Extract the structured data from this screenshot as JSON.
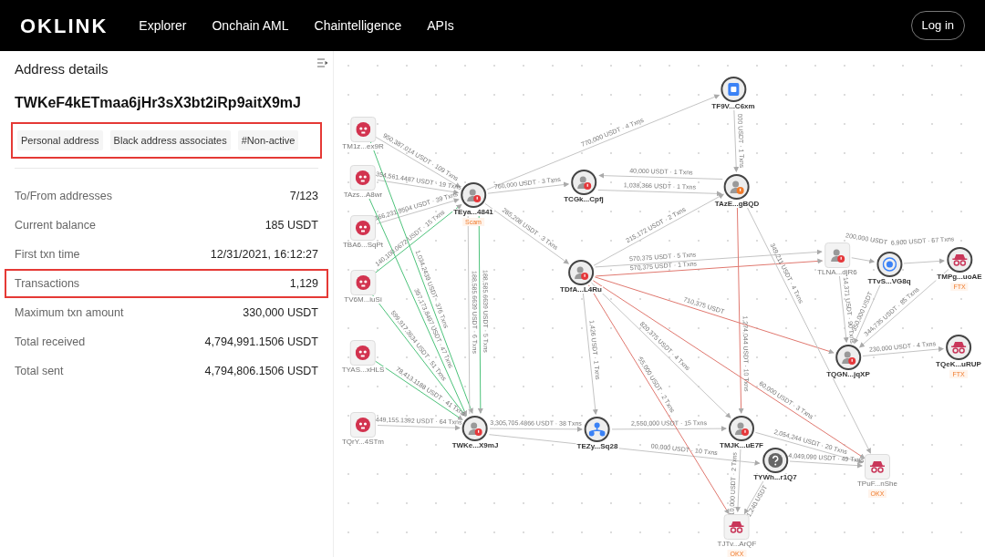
{
  "nav": {
    "logo": "OKLINK",
    "links": [
      "Explorer",
      "Onchain AML",
      "Chaintelligence",
      "APIs"
    ],
    "login": "Log in"
  },
  "details": {
    "title": "Address details",
    "address": "TWKeF4kETmaa6jHr3sX3bt2iRp9aitX9mJ",
    "tags": [
      "Personal address",
      "Black address associates",
      "#Non-active"
    ],
    "tags_highlighted": true,
    "rows": [
      {
        "label": "To/From addresses",
        "value": "7/123",
        "highlighted": false
      },
      {
        "label": "Current balance",
        "value": "185 USDT",
        "highlighted": false
      },
      {
        "label": "First txn time",
        "value": "12/31/2021, 16:12:27",
        "highlighted": false
      },
      {
        "label": "Transactions",
        "value": "1,129",
        "highlighted": true
      },
      {
        "label": "Maximum txn amount",
        "value": "330,000 USDT",
        "highlighted": false
      },
      {
        "label": "Total received",
        "value": "4,794,991.1506 USDT",
        "highlighted": false
      },
      {
        "label": "Total sent",
        "value": "4,794,806.1506 USDT",
        "highlighted": false
      }
    ]
  },
  "graph": {
    "nodes": [
      {
        "label": "TM1z...ex9R",
        "kind": "risk"
      },
      {
        "label": "TAzs...A8wr",
        "kind": "risk"
      },
      {
        "label": "TBA6...SqPt",
        "kind": "risk"
      },
      {
        "label": "TV6M...iuSi",
        "kind": "risk"
      },
      {
        "label": "TYAS...xHLS",
        "kind": "risk"
      },
      {
        "label": "TQrY...4STm",
        "kind": "risk"
      },
      {
        "label": "TEya...4841",
        "kind": "address",
        "color": "#e5383b",
        "tag": "Scam"
      },
      {
        "label": "TWKe...X9mJ",
        "kind": "address",
        "color": "#e5383b"
      },
      {
        "label": "TCGk...Cpfj",
        "kind": "address",
        "color": "#e5383b"
      },
      {
        "label": "TF9V...C6xm",
        "kind": "contract"
      },
      {
        "label": "TAzE...gBQD",
        "kind": "address",
        "color": "#f07a2a"
      },
      {
        "label": "TDfA...L4Ru",
        "kind": "address",
        "color": "#e5383b"
      },
      {
        "label": "TEZy...Sq28",
        "kind": "hub"
      },
      {
        "label": "TLNA...djR6",
        "kind": "address",
        "color": "#e5383b"
      },
      {
        "label": "TTvS...VG8q",
        "kind": "exchange"
      },
      {
        "label": "TMPg...uoAE",
        "kind": "entity",
        "tag": "FTX"
      },
      {
        "label": "TQGN...jqXP",
        "kind": "address",
        "color": "#e5383b"
      },
      {
        "label": "TQeK...uRUP",
        "kind": "entity",
        "tag": "FTX"
      },
      {
        "label": "TMJK...uE7F",
        "kind": "address",
        "color": "#e5383b"
      },
      {
        "label": "TYWh...r1Q7",
        "kind": "unknown"
      },
      {
        "label": "TPuF...nShe",
        "kind": "entity",
        "tag": "OKX"
      },
      {
        "label": "TJTv...ArQF",
        "kind": "entity",
        "tag": "OKX"
      }
    ],
    "edges": [
      {
        "label": "950,387.014 USDT · 109 Txns",
        "color": "#c4c4c4"
      },
      {
        "label": "354,561.4487 USDT · 19 Txns",
        "color": "#c4c4c4"
      },
      {
        "label": "166,231.9504 USDT · 39 Txns",
        "color": "#c4c4c4"
      },
      {
        "label": "140,100.0672 USDT · 15 Txns",
        "color": "#4cc27a"
      },
      {
        "label": "1,034.2439 USDT · 376 Txns",
        "color": "#4cc27a"
      },
      {
        "label": "397,173.8497 USDT · 47 Txns",
        "color": "#4cc27a"
      },
      {
        "label": "188,585.6639 USDT · 5 Txns",
        "color": "#4cc27a"
      },
      {
        "label": "188,585.6639 USDT · 6 Txns",
        "color": "#c4c4c4"
      },
      {
        "label": "599,917.3634 USDT · 51 Txns",
        "color": "#4cc27a"
      },
      {
        "label": "78,413.1188 USDT · 41 Txns",
        "color": "#4cc27a"
      },
      {
        "label": "449,155.1392 USDT · 64 Txns",
        "color": "#c4c4c4"
      },
      {
        "label": "770,000 USDT · 4 Txns",
        "color": "#c4c4c4"
      },
      {
        "label": "760,000 USDT · 3 Txns",
        "color": "#c4c4c4"
      },
      {
        "label": "40,000 USDT · 1 Txns",
        "color": "#c4c4c4"
      },
      {
        "label": "1,038,366 USDT · 1 Txns",
        "color": "#c4c4c4"
      },
      {
        "label": "000 USDT · 1 Txns",
        "color": "#c4c4c4"
      },
      {
        "label": "285,208 USDT · 3 Txns",
        "color": "#c4c4c4"
      },
      {
        "label": "215,172 USDT · 2 Txns",
        "color": "#c4c4c4"
      },
      {
        "label": "570,375 USDT · 5 Txns",
        "color": "#c4c4c4"
      },
      {
        "label": "570,375 USDT · 1 Txns",
        "color": "#e0786f"
      },
      {
        "label": "710,375 USDT",
        "color": "#e0786f"
      },
      {
        "label": "1,274,044 USDT · 10 Txns",
        "color": "#e0786f"
      },
      {
        "label": "349,211 USDT · 4 Txns",
        "color": "#c4c4c4"
      },
      {
        "label": "3,305,705.4866 USDT · 38 Txns",
        "color": "#c4c4c4"
      },
      {
        "label": "00,000 USDT · 10 Txns",
        "color": "#c4c4c4"
      },
      {
        "label": "1,426 USDT · 1 Txns",
        "color": "#c4c4c4"
      },
      {
        "label": "2,550,000 USDT · 15 Txns",
        "color": "#c4c4c4"
      },
      {
        "label": "820,375 USDT · 4 Txns",
        "color": "#c4c4c4"
      },
      {
        "label": "55,000 USDT · 2 Txns",
        "color": "#e0786f"
      },
      {
        "label": "60,000 USDT · 3 Txns",
        "color": "#e0786f"
      },
      {
        "label": "2,054,244 USDT · 20 Txns",
        "color": "#c4c4c4"
      },
      {
        "label": "4,049,090 USDT · 49 Txns",
        "color": "#c4c4c4"
      },
      {
        "label": "10,000 USDT · 2 Txns",
        "color": "#c4c4c4"
      },
      {
        "label": "1,240 USDT",
        "color": "#c4c4c4"
      },
      {
        "label": "230,000 USDT · 4 Txns",
        "color": "#c4c4c4"
      },
      {
        "label": "350,000 USDT",
        "color": "#c4c4c4"
      },
      {
        "label": "200,000 USDT",
        "color": "#c4c4c4"
      },
      {
        "label": "6,900 USDT · 57 Txns",
        "color": "#c4c4c4"
      },
      {
        "label": "14,371 USDT · 90 Txns",
        "color": "#c4c4c4"
      },
      {
        "label": "344,735 USDT · 85 Txns",
        "color": "#c4c4c4"
      }
    ]
  }
}
